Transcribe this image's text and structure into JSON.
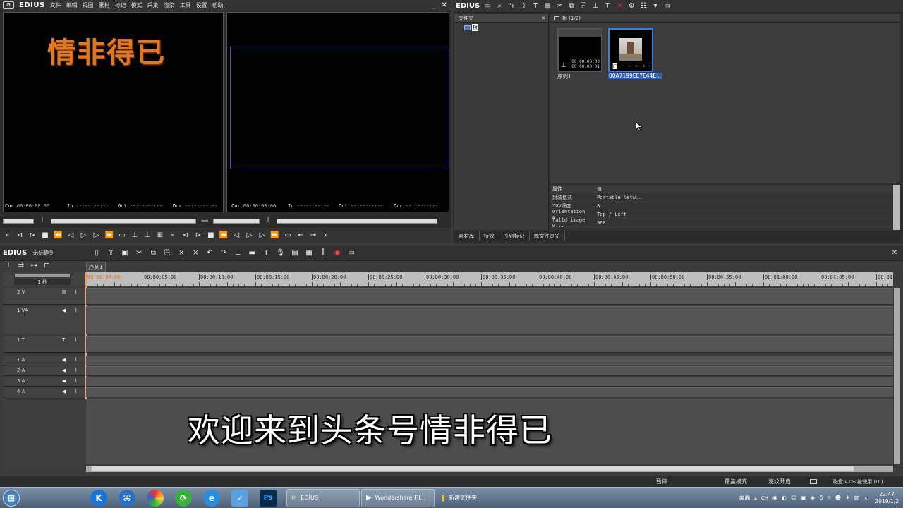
{
  "colors": {
    "accent": "#3a7fd5",
    "playhead": "#ff9a3a",
    "title_text": "#e07a1f"
  },
  "app": {
    "name": "EDIUS",
    "project": "无标题9"
  },
  "menu": [
    "文件",
    "编辑",
    "视图",
    "素材",
    "标记",
    "模式",
    "采集",
    "渲染",
    "工具",
    "设置",
    "帮助"
  ],
  "player": {
    "title_text": "情非得已",
    "cur_label": "Cur",
    "cur_value": "00:00:00:00",
    "in_label": "In",
    "in_value": "--:--:--:--",
    "out_label": "Out",
    "out_value": "--:--:--:--",
    "dur_label": "Dur",
    "dur_value": "--:--:--:--"
  },
  "recorder": {
    "cur_label": "Cur",
    "cur_value": "00:00:00:00",
    "in_label": "In",
    "in_value": "--:--:--:--",
    "out_label": "Out",
    "out_value": "--:--:--:--",
    "dur_label": "Dur",
    "dur_value": "--:--:--:--"
  },
  "bin": {
    "logo": "EDIUS",
    "folder_header": "文件夹",
    "folder_root": "根",
    "root_header": "根 (1/2)",
    "clips": [
      {
        "name": "序列1",
        "tc1": "00:00:00:00",
        "tc2": "00:00:00:01",
        "icon": "sequence-icon"
      },
      {
        "name": "00A7199EE7E44E...",
        "tc1": "--:--:--:--",
        "icon": "camera-icon"
      }
    ],
    "props_header": {
      "k": "属性",
      "v": "值"
    },
    "props": [
      {
        "k": "封装格式",
        "v": "Portable Netw..."
      },
      {
        "k": "YUV深度",
        "v": "8"
      },
      {
        "k": "Orientation o...",
        "v": "Top / Left"
      },
      {
        "k": "Valid image w...",
        "v": "960"
      }
    ],
    "tabs": [
      "素材库",
      "特效",
      "序列标记",
      "源文件浏览"
    ]
  },
  "timeline": {
    "sequence_tab": "序列1",
    "scale": "1 秒",
    "ruler_labels": [
      "00:00:00:00",
      "00:00:05:00",
      "00:00:10:00",
      "00:00:15:00",
      "00:00:20:00",
      "00:00:25:00",
      "00:00:30:00",
      "00:00:35:00",
      "00:00:40:00",
      "00:00:45:00",
      "00:00:50:00",
      "00:00:55:00",
      "00:01:00:00",
      "00:01:05:00",
      "00:01:"
    ],
    "tracks": [
      {
        "label": "2 V"
      },
      {
        "label": "1 VA"
      },
      {
        "label": "1 T"
      },
      {
        "label": "1 A"
      },
      {
        "label": "2 A"
      },
      {
        "label": "3 A"
      },
      {
        "label": "4 A"
      }
    ],
    "subtitle": "欢迎来到头条号情非得已"
  },
  "status": {
    "pause": "暂停",
    "mode": "覆盖模式",
    "ripple": "波纹开启",
    "disk": "磁盘:41% 被使用 (D:)"
  },
  "taskbar": {
    "tasks": [
      {
        "label": "EDIUS"
      },
      {
        "label": "Wondershare Fil..."
      },
      {
        "label": "新建文件夹"
      }
    ],
    "tray_label": "桌面",
    "lang": "CH",
    "time": "22:47",
    "date": "2019/1/2"
  }
}
